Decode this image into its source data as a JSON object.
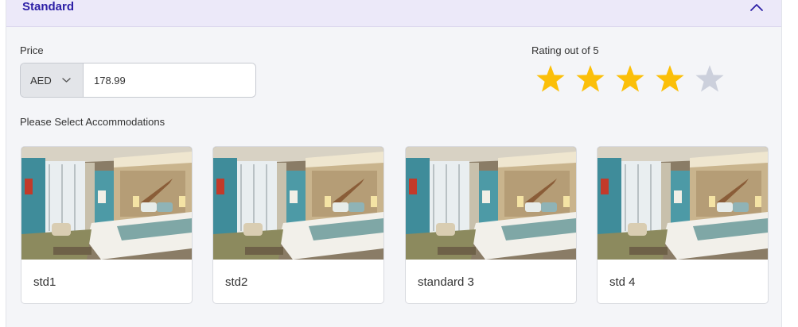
{
  "section": {
    "title": "Standard"
  },
  "price": {
    "label": "Price",
    "currency": "AED",
    "value": "178.99"
  },
  "rating": {
    "label": "Rating out of 5",
    "value": 4,
    "max": 5,
    "filled_color": "#fbbf09",
    "empty_color": "#ccd0dc"
  },
  "accommodations": {
    "label": "Please Select Accommodations",
    "items": [
      {
        "name": "std1"
      },
      {
        "name": "std2"
      },
      {
        "name": "standard 3"
      },
      {
        "name": "std 4"
      }
    ]
  },
  "colors": {
    "accent": "#2c1fa6",
    "header_bg": "#ece9f9",
    "panel_bg": "#f4f5f8"
  }
}
